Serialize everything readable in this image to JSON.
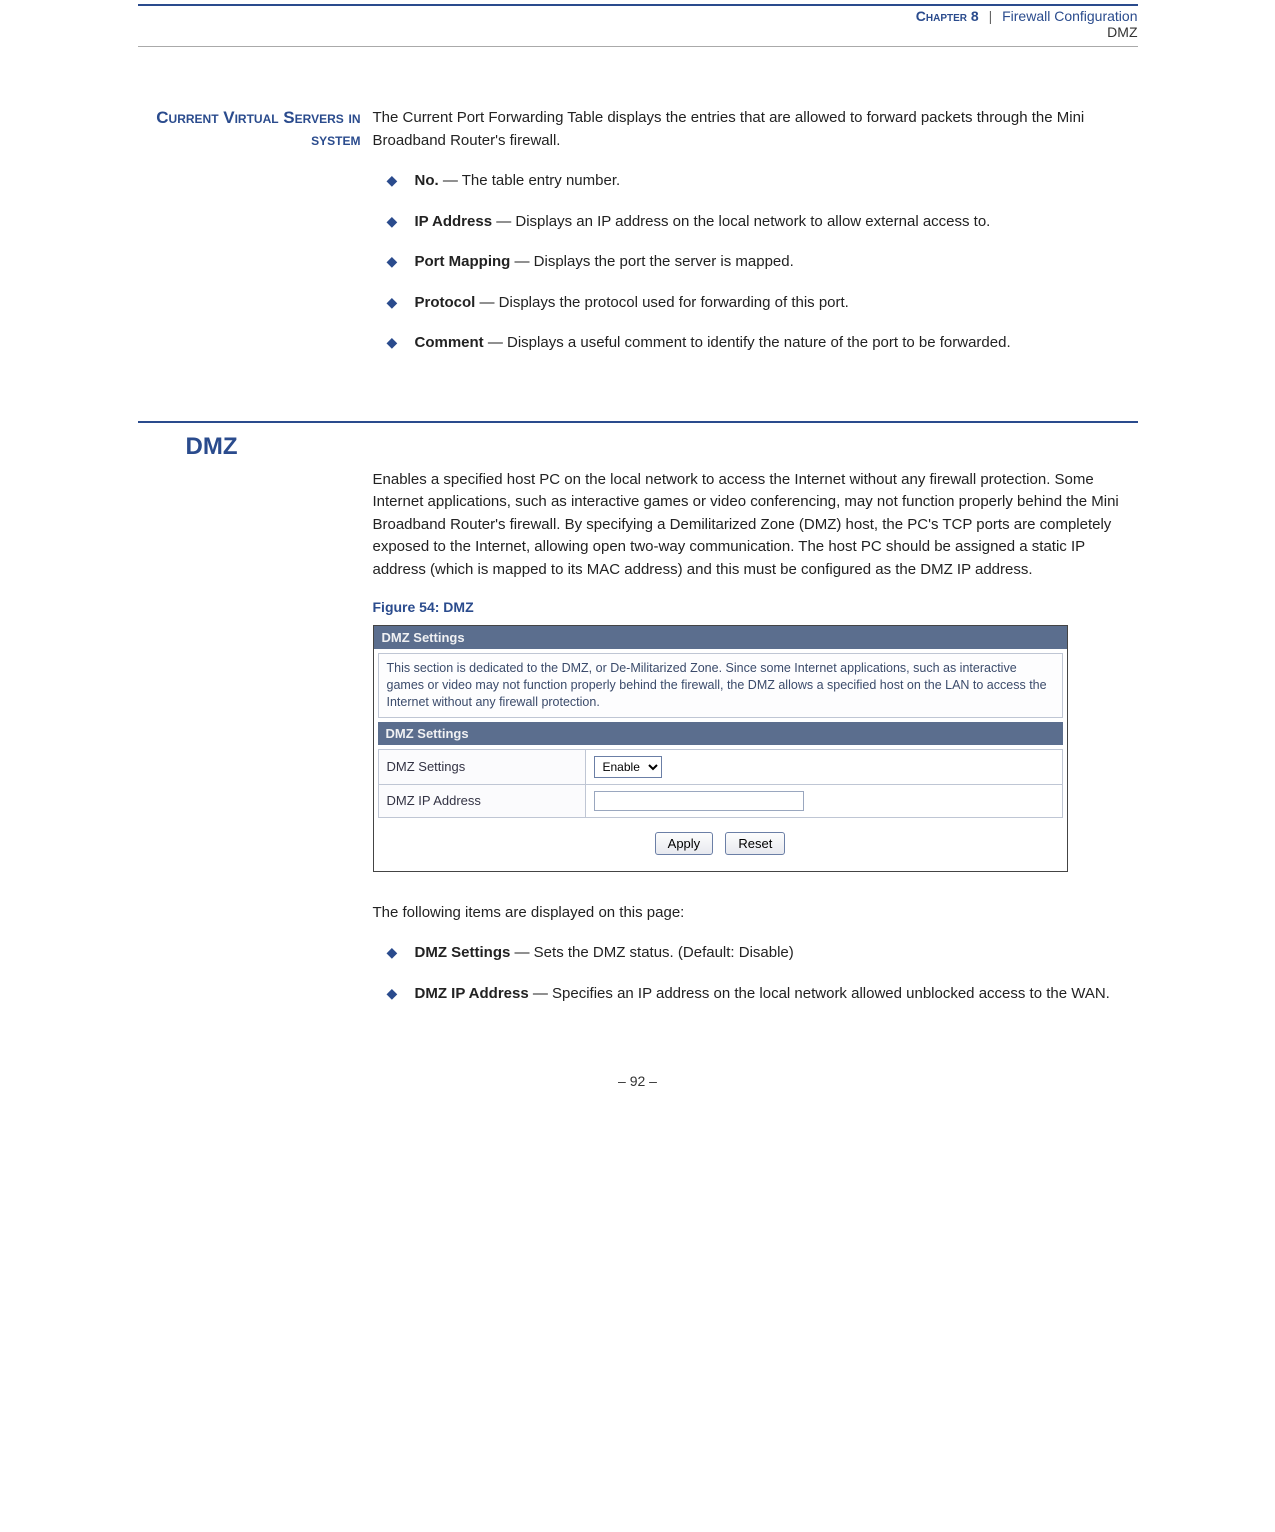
{
  "header": {
    "chapter": "Chapter 8",
    "sep": "|",
    "title": "Firewall Configuration",
    "sub": "DMZ"
  },
  "section1": {
    "side_heading": "Current Virtual Servers in system",
    "intro": "The Current Port Forwarding Table displays the entries that are allowed to forward packets through the Mini Broadband Router's firewall.",
    "items": [
      {
        "term": "No.",
        "desc": " — The table entry number."
      },
      {
        "term": "IP Address",
        "desc": " — Displays an IP address on the local network to allow external access to."
      },
      {
        "term": "Port Mapping",
        "desc": " — Displays the port the server is mapped."
      },
      {
        "term": "Protocol",
        "desc": " — Displays the protocol used for forwarding of this port."
      },
      {
        "term": "Comment",
        "desc": " — Displays a useful comment to identify the nature of the port to be forwarded."
      }
    ]
  },
  "section2": {
    "heading": "DMZ",
    "intro": "Enables a specified host PC on the local network to access the Internet without any firewall protection. Some Internet applications, such as interactive games or video conferencing, may not function properly behind the Mini Broadband Router's firewall. By specifying a Demilitarized Zone (DMZ) host, the PC's TCP ports are completely exposed to the Internet, allowing open two-way communication. The host PC should be assigned a static IP address (which is mapped to its MAC address) and this must be configured as the DMZ IP address.",
    "figure_caption": "Figure 54:  DMZ",
    "figure": {
      "bar1": "DMZ Settings",
      "desc": "This section is dedicated to the DMZ, or De-Militarized Zone. Since some Internet applications, such as interactive games or video may not function properly behind the firewall, the DMZ allows a specified host on the LAN to access the Internet without any firewall protection.",
      "bar2": "DMZ Settings",
      "row1_label": "DMZ Settings",
      "row1_value": "Enable",
      "row2_label": "DMZ IP Address",
      "row2_value": "",
      "btn_apply": "Apply",
      "btn_reset": "Reset"
    },
    "after_figure": "The following items are displayed on this page:",
    "items": [
      {
        "term": "DMZ Settings",
        "desc": " — Sets the DMZ status. (Default: Disable)"
      },
      {
        "term": "DMZ IP Address",
        "desc": " — Specifies an IP address on the local network allowed unblocked access to the WAN."
      }
    ]
  },
  "footer": {
    "page": "–  92  –"
  }
}
